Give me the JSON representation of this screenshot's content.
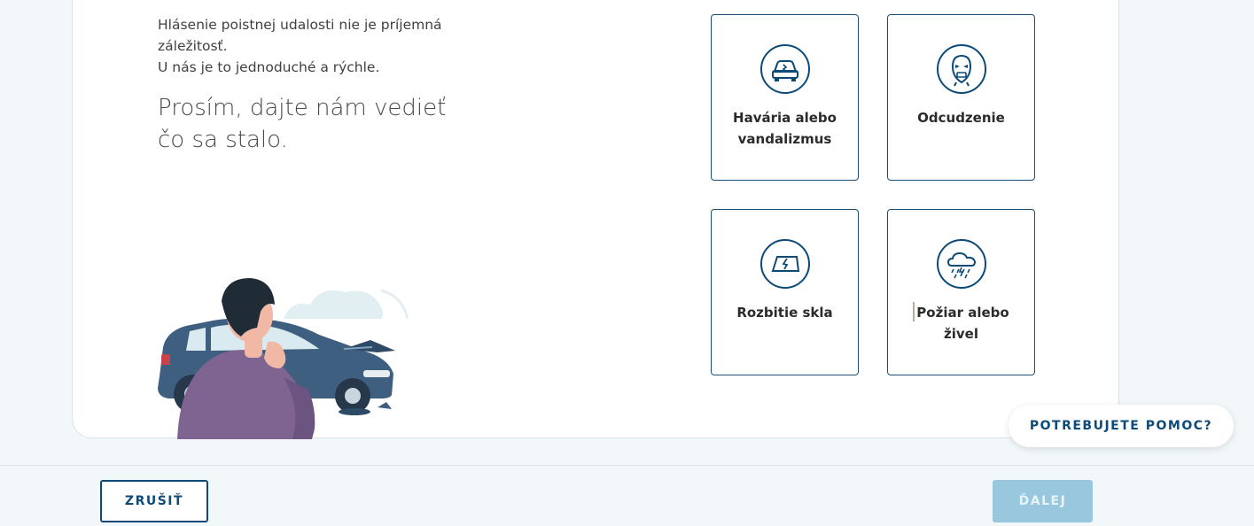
{
  "intro": {
    "line1": "Hlásenie poistnej udalosti nie je príjemná záležitosť.",
    "line2": "U nás je to jednoduché a rýchle."
  },
  "question": {
    "line1": "Prosím, dajte nám vedieť",
    "line2": "čo sa stalo."
  },
  "options": [
    {
      "label": "Havária alebo vandalizmus",
      "icon": "car-crash-icon"
    },
    {
      "label": "Odcudzenie",
      "icon": "thief-mask-icon"
    },
    {
      "label": "Rozbitie skla",
      "icon": "broken-glass-icon"
    },
    {
      "label": "Požiar alebo živel",
      "icon": "storm-cloud-icon"
    }
  ],
  "help": {
    "label": "POTREBUJETE POMOC?"
  },
  "footer": {
    "cancel_label": "ZRUŠIŤ",
    "next_label": "ĎALEJ"
  },
  "colors": {
    "primary": "#0d4a78",
    "tile_border": "#1c4e75",
    "next_disabled": "#99c8de",
    "background": "#f2f8fa"
  }
}
